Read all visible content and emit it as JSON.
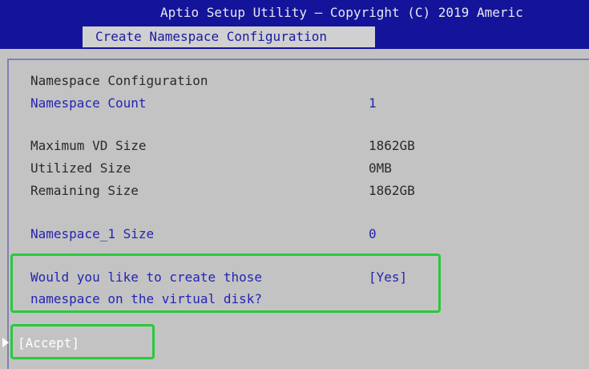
{
  "header": {
    "title": "Aptio Setup Utility – Copyright (C) 2019 Americ",
    "tab_label": "Create Namespace Configuration"
  },
  "form": {
    "section_title": "Namespace Configuration",
    "namespace_count": {
      "label": "Namespace Count",
      "value": "1"
    },
    "max_vd_size": {
      "label": "Maximum VD Size",
      "value": "1862GB"
    },
    "utilized_size": {
      "label": "Utilized Size",
      "value": "0MB"
    },
    "remaining_size": {
      "label": "Remaining Size",
      "value": "1862GB"
    },
    "namespace_1_size": {
      "label": "Namespace_1 Size",
      "value": "0"
    },
    "create_prompt": {
      "line1": "Would you like to create those",
      "line2": "namespace on the virtual disk?",
      "value": "[Yes]"
    },
    "accept_label": "[Accept]"
  },
  "colors": {
    "header_bg": "#14149a",
    "panel_bg": "#c3c3c3",
    "selectable_text": "#2424b4",
    "highlight_box": "#2ac93a"
  }
}
